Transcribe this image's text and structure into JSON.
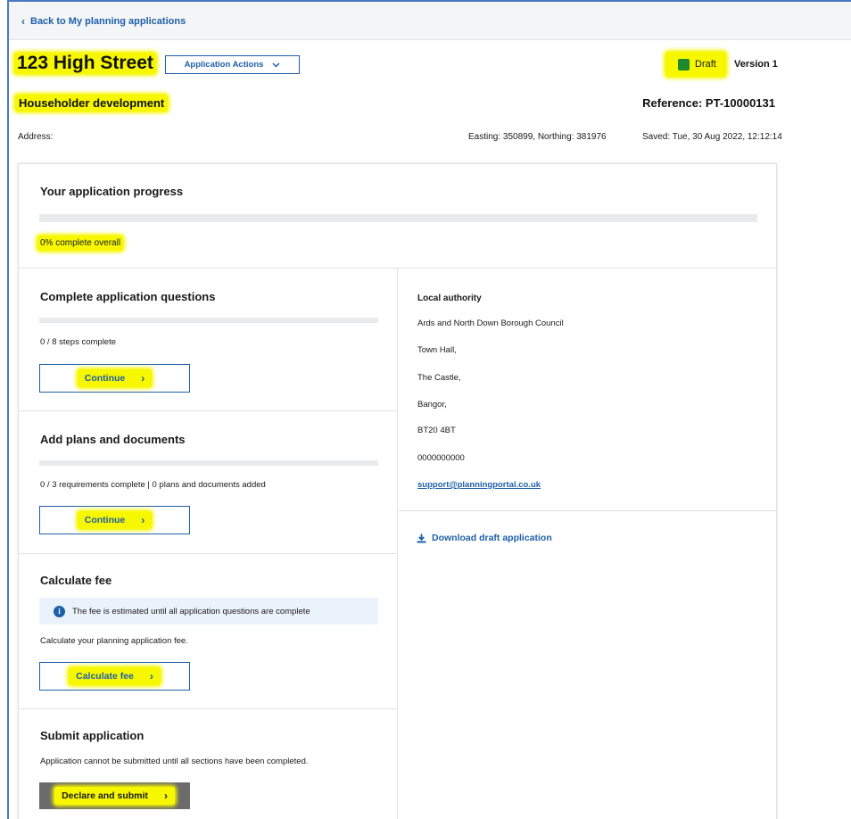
{
  "nav": {
    "back_label": "Back to My planning applications"
  },
  "header": {
    "title": "123 High Street",
    "actions_label": "Application Actions",
    "status": "Draft",
    "status_color": "#1e8a2e",
    "version": "Version 1",
    "subtitle": "Householder development",
    "reference": "Reference: PT-10000131",
    "address_label": "Address:",
    "coordinates": "Easting: 350899, Northing: 381976",
    "saved": "Saved: Tue, 30 Aug 2022, 12:12:14"
  },
  "progress": {
    "title": "Your application progress",
    "percent_value": 0,
    "percent_text": "0% complete overall"
  },
  "sections": {
    "questions": {
      "title": "Complete application questions",
      "status": "0 / 8 steps complete",
      "button": "Continue"
    },
    "documents": {
      "title": "Add plans and documents",
      "status": "0 / 3 requirements complete | 0 plans and documents added",
      "button": "Continue"
    },
    "fee": {
      "title": "Calculate fee",
      "info": "The fee is estimated until all application questions are complete",
      "text": "Calculate your planning application fee.",
      "button": "Calculate fee"
    },
    "submit": {
      "title": "Submit application",
      "text": "Application cannot be submitted until all sections have been completed.",
      "button": "Declare and submit"
    }
  },
  "authority": {
    "title": "Local authority",
    "lines": [
      "Ards and North Down Borough Council",
      "Town Hall,",
      "The Castle,",
      "Bangor,",
      "BT20 4BT",
      "0000000000"
    ],
    "email": "support@planningportal.co.uk"
  },
  "download_label": "Download draft application",
  "colors": {
    "accent": "#1d5fa8",
    "highlight": "#f7f700",
    "draft": "#1e8a2e"
  }
}
